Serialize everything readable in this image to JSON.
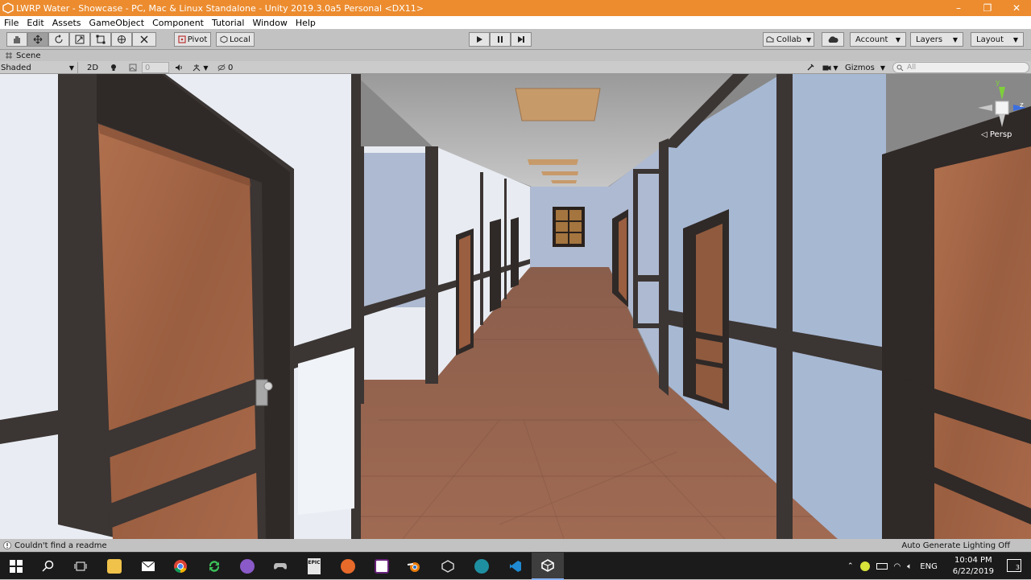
{
  "window": {
    "title": "LWRP Water - Showcase - PC, Mac & Linux Standalone - Unity 2019.3.0a5 Personal <DX11>",
    "minimize": "–",
    "maximize": "❐",
    "close": "✕"
  },
  "menu": [
    "File",
    "Edit",
    "Assets",
    "GameObject",
    "Component",
    "Tutorial",
    "Window",
    "Help"
  ],
  "toolbar": {
    "pivot": "Pivot",
    "local": "Local",
    "collab": "Collab",
    "account": "Account",
    "layers": "Layers",
    "layout": "Layout"
  },
  "scene": {
    "tab_label": "Scene",
    "shading_mode": "Shaded",
    "mode_2d": "2D",
    "effects_count": "0",
    "hidden_count": "0",
    "gizmos": "Gizmos",
    "search_placeholder": "All",
    "persp_label": "Persp",
    "axis_y": "y",
    "axis_z": "z"
  },
  "status": {
    "message": "Couldn't find a readme",
    "lighting": "Auto Generate Lighting Off"
  },
  "taskbar": {
    "language": "ENG",
    "time": "10:04 PM",
    "date": "6/22/2019",
    "notifications": "3",
    "epic_label": "EPIC"
  },
  "colors": {
    "titlebar": "#ec8c2f",
    "editor_bg": "#c2c2c2",
    "taskbar": "#1b1b1b",
    "wall": "#b7c4d6",
    "wood": "#a2684a",
    "frame": "#3b3533"
  }
}
